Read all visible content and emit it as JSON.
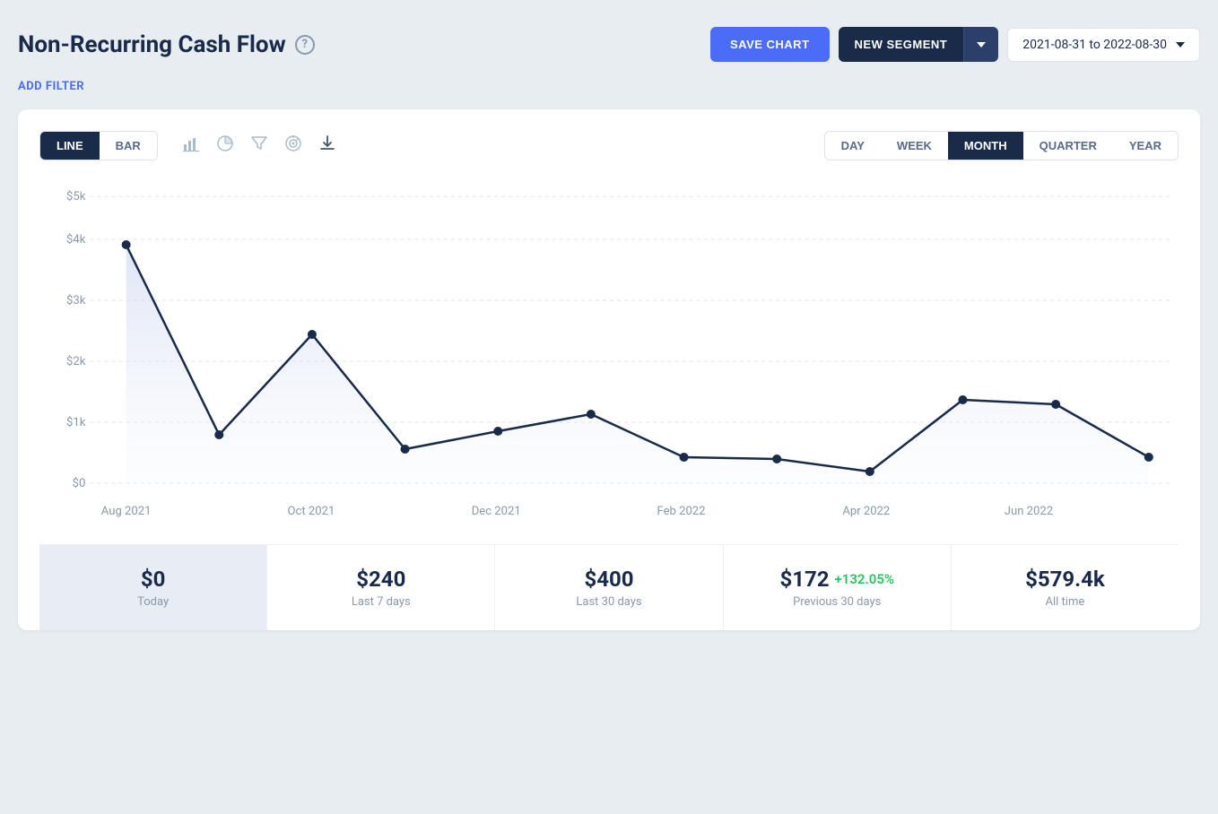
{
  "header": {
    "title": "Non-Recurring Cash Flow",
    "help_icon": "?",
    "save_chart_label": "SAVE CHART",
    "new_segment_label": "NEW SEGMENT",
    "date_range": "2021-08-31 to 2022-08-30"
  },
  "filter": {
    "label": "ADD FILTER"
  },
  "chart": {
    "type_buttons": [
      {
        "label": "LINE",
        "active": true
      },
      {
        "label": "BAR",
        "active": false
      }
    ],
    "period_buttons": [
      {
        "label": "DAY",
        "active": false
      },
      {
        "label": "WEEK",
        "active": false
      },
      {
        "label": "MONTH",
        "active": true
      },
      {
        "label": "QUARTER",
        "active": false
      },
      {
        "label": "YEAR",
        "active": false
      }
    ],
    "y_axis_labels": [
      "$5k",
      "$4k",
      "$3k",
      "$2k",
      "$1k",
      "$0"
    ],
    "x_axis_labels": [
      "Aug 2021",
      "Oct 2021",
      "Dec 2021",
      "Feb 2022",
      "Apr 2022",
      "Jun 2022"
    ],
    "icons": [
      "bar-chart-icon",
      "pie-chart-icon",
      "funnel-icon",
      "target-icon",
      "download-icon"
    ]
  },
  "stats": [
    {
      "value": "$0",
      "label": "Today",
      "highlighted": true
    },
    {
      "value": "$240",
      "label": "Last 7 days",
      "highlighted": false
    },
    {
      "value": "$400",
      "label": "Last 30 days",
      "highlighted": false
    },
    {
      "value": "$172",
      "label": "Previous 30 days",
      "highlighted": false,
      "change": "+132.05%"
    },
    {
      "value": "$579.4k",
      "label": "All time",
      "highlighted": false
    }
  ]
}
